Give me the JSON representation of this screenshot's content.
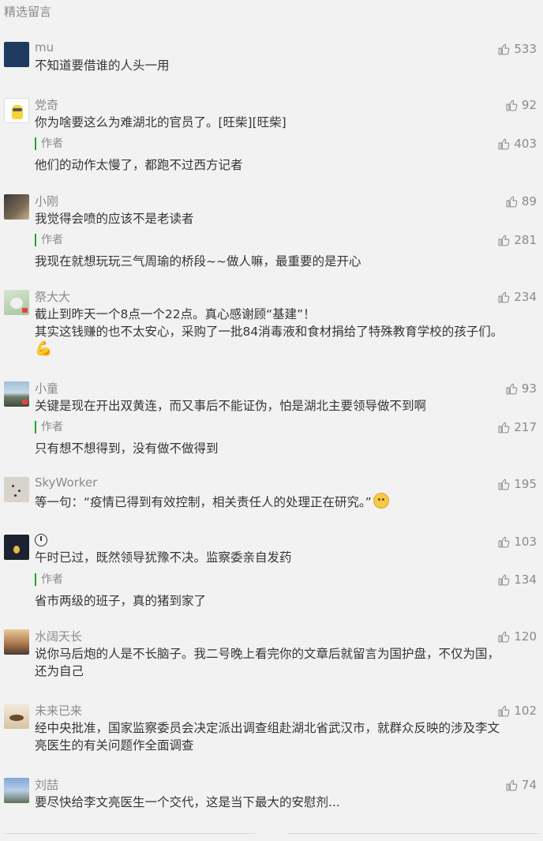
{
  "section_title": "精选留言",
  "author_label": "作者",
  "comments": [
    {
      "nickname": "mu",
      "likes": "533",
      "text": "不知道要借谁的人头一用"
    },
    {
      "nickname": "党奇",
      "likes": "92",
      "text": "你为啥要这么为难湖北的官员了。[旺柴][旺柴]",
      "reply": {
        "likes": "403",
        "text": "他们的动作太慢了，都跑不过西方记者"
      }
    },
    {
      "nickname": "小刚",
      "likes": "89",
      "text": "我觉得会喷的应该不是老读者",
      "reply": {
        "likes": "281",
        "text": "我现在就想玩玩三气周瑜的桥段~~做人嘛，最重要的是开心"
      }
    },
    {
      "nickname": "祭大大",
      "likes": "234",
      "text_lines": [
        "截止到昨天一个8点一个22点。真心感谢顾“基建”！",
        "其实这钱赚的也不太安心，采购了一批84消毒液和食材捐给了特殊教育学校的孩子们。"
      ],
      "emoji": "muscle-emoji"
    },
    {
      "nickname": "小童",
      "likes": "93",
      "text": "关键是现在开出双黄连，而又事后不能证伪，怕是湖北主要领导做不到啊",
      "reply": {
        "likes": "217",
        "text": "只有想不想得到，没有做不做得到"
      }
    },
    {
      "nickname": "SkyWorker",
      "likes": "195",
      "text": "等一句：“疫情已得到有效控制，相关责任人的处理正在研究。”"
    },
    {
      "nickname": "",
      "nickname_icon": "clock-icon",
      "likes": "103",
      "text": "午时已过，既然领导犹豫不决。监察委亲自发药",
      "reply": {
        "likes": "134",
        "text": "省市两级的班子，真的猪到家了"
      }
    },
    {
      "nickname": "水阔天长",
      "likes": "120",
      "text_lines": [
        "说你马后炮的人是不长脑子。我二号晚上看完你的文章后就留言为国护盘，不仅为国，",
        "还为自己"
      ]
    },
    {
      "nickname": "未来已来",
      "likes": "102",
      "text_lines": [
        "经中央批准，国家监察委员会决定派出调查组赴湖北省武汉市，就群众反映的涉及李文",
        "亮医生的有关问题作全面调查"
      ]
    },
    {
      "nickname": "刘喆",
      "likes": "74",
      "text": "要尽快给李文亮医生一个交代，这是当下最大的安慰剂..."
    }
  ]
}
